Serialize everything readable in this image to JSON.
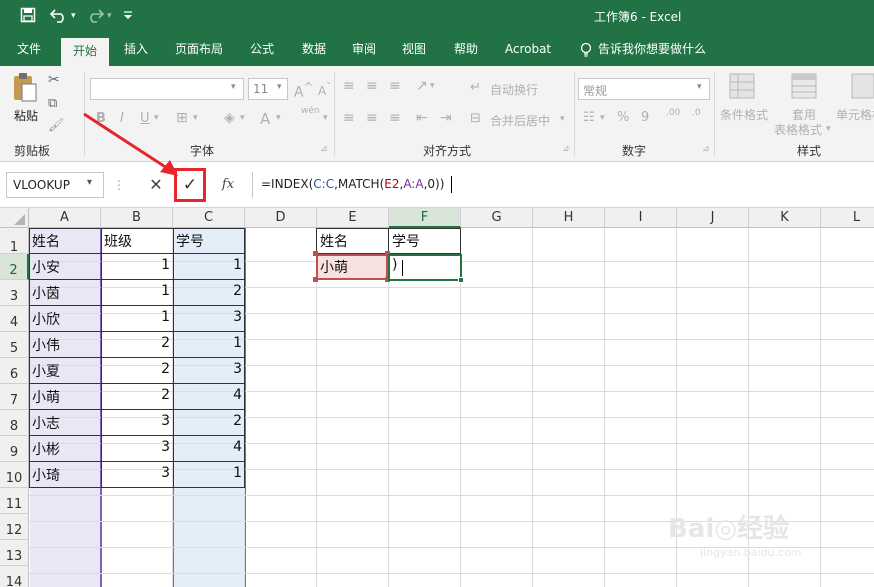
{
  "window": {
    "title": "工作簿6 - Excel"
  },
  "quick_access": {
    "save": "save-icon",
    "undo": "undo-icon",
    "redo": "redo-icon",
    "customize": "customize-icon"
  },
  "tabs": [
    "文件",
    "开始",
    "插入",
    "页面布局",
    "公式",
    "数据",
    "审阅",
    "视图",
    "帮助",
    "Acrobat",
    "告诉我你想要做什么"
  ],
  "ribbon": {
    "clipboard": {
      "paste": "粘贴",
      "label": "剪贴板"
    },
    "font": {
      "size": "11",
      "bold": "B",
      "italic": "I",
      "underline": "U",
      "label": "字体",
      "font_a": "A",
      "wen": "wén"
    },
    "alignment": {
      "wrap": "自动换行",
      "merge": "合并后居中",
      "label": "对齐方式"
    },
    "number": {
      "format": "常规",
      "percent": "%",
      "comma": "9",
      "dec_inc": ".00",
      "dec_dec": ".0",
      "label": "数字"
    },
    "styles": {
      "conditional": "条件格式",
      "table1": "套用",
      "table2": "表格格式",
      "cell": "单元格样",
      "label": "样式"
    }
  },
  "formula_bar": {
    "name_box": "VLOOKUP",
    "cancel": "✕",
    "enter": "✓",
    "fx": "fx",
    "formula": "=INDEX(C:C,MATCH(E2,A:A,0))"
  },
  "columns": [
    "A",
    "B",
    "C",
    "D",
    "E",
    "F",
    "G",
    "H",
    "I",
    "J",
    "K",
    "L"
  ],
  "rows": [
    "1",
    "2",
    "3",
    "4",
    "5",
    "6",
    "7",
    "8",
    "9",
    "10",
    "11",
    "12",
    "13",
    "14"
  ],
  "table": {
    "headers": [
      "姓名",
      "班级",
      "学号"
    ],
    "records": [
      [
        "小安",
        "1",
        "1"
      ],
      [
        "小茵",
        "1",
        "2"
      ],
      [
        "小欣",
        "1",
        "3"
      ],
      [
        "小伟",
        "2",
        "1"
      ],
      [
        "小夏",
        "2",
        "3"
      ],
      [
        "小萌",
        "2",
        "4"
      ],
      [
        "小志",
        "3",
        "2"
      ],
      [
        "小彬",
        "3",
        "4"
      ],
      [
        "小琦",
        "3",
        "1"
      ]
    ]
  },
  "lookup": {
    "name_header": "姓名",
    "id_header": "学号",
    "name_value": "小萌",
    "editing_value": ")"
  },
  "colors": {
    "brand": "#217346",
    "highlight_a": "#ebe6f5",
    "highlight_c": "#e3eef8",
    "ref_red": "#c00000",
    "ref_blue": "#2f5597",
    "ref_purple": "#7030a0",
    "annotation": "#e8252a"
  }
}
